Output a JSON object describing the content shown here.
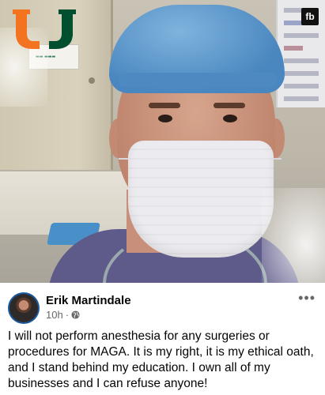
{
  "photo": {
    "logo": "university-u-logo",
    "corner_badge": "fb"
  },
  "post": {
    "author_name": "Erik Martindale",
    "timestamp": "10h",
    "separator": "·",
    "privacy_icon": "globe-icon",
    "more_label": "•••",
    "body": "I will not perform anesthesia for any surgeries or procedures for MAGA. It is my right, it is my ethical oath, and I stand behind my education. I own all of my businesses and I can refuse anyone!"
  },
  "colors": {
    "logo_orange": "#f47321",
    "logo_green": "#005030",
    "meta_gray": "#65676b",
    "text": "#050505"
  }
}
